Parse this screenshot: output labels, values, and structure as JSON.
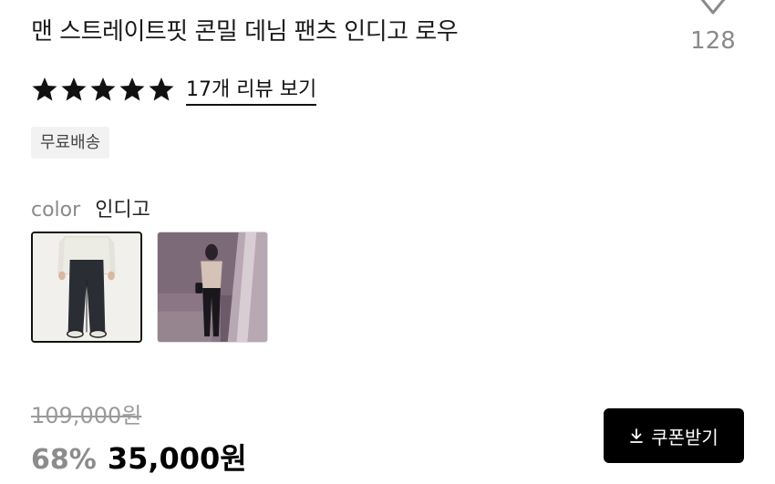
{
  "product": {
    "title": "맨 스트레이트핏 콘밀 데님 팬츠 인디고 로우",
    "like_count": "128",
    "rating_stars": 5,
    "review_link": "17개 리뷰 보기",
    "shipping_badge": "무료배송",
    "color_label": "color",
    "color_value": "인디고",
    "swatches": [
      {
        "name": "swatch-studio",
        "selected": true
      },
      {
        "name": "swatch-lifestyle",
        "selected": false
      }
    ]
  },
  "price": {
    "original": "109,000원",
    "discount": "68%",
    "sale": "35,000원"
  },
  "actions": {
    "coupon_label": "쿠폰받기"
  },
  "icons": {
    "like": "heart-icon",
    "star": "star-icon",
    "download": "download-icon"
  },
  "colors": {
    "accent": "#000000",
    "muted": "#8a8a8a",
    "badge_bg": "#f2f2f2"
  }
}
